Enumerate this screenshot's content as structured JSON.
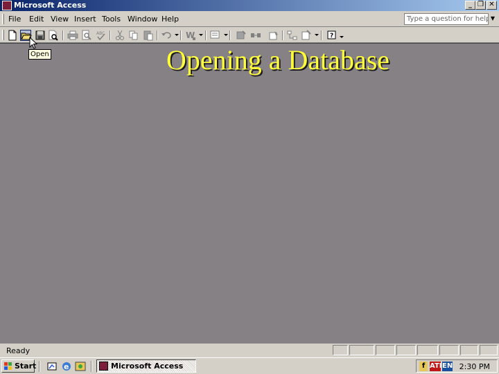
{
  "window": {
    "title": "Microsoft Access"
  },
  "menu": {
    "items": [
      "File",
      "Edit",
      "View",
      "Insert",
      "Tools",
      "Window",
      "Help"
    ]
  },
  "help_search": {
    "placeholder": "Type a question for help"
  },
  "tooltip": {
    "text": "Open"
  },
  "slide": {
    "title": "Opening a Database",
    "title_color": "#ffff3a"
  },
  "status": {
    "text": "Ready"
  },
  "taskbar": {
    "start_label": "Start",
    "task_label": "Microsoft Access",
    "tray_lang": "EN",
    "clock": "2:30 PM"
  }
}
